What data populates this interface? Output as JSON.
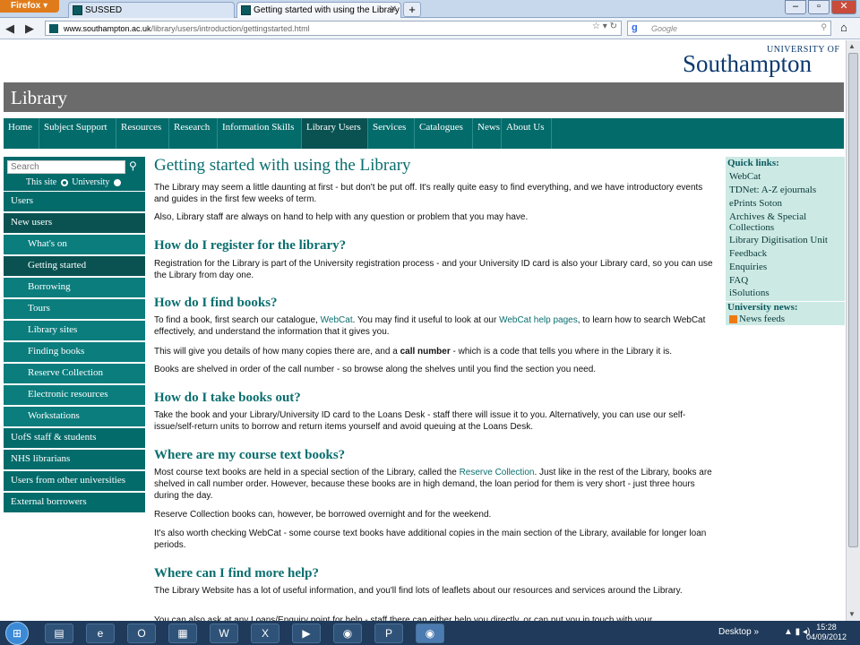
{
  "browser": {
    "firefox_label": "Firefox",
    "tabs": [
      {
        "label": "SUSSED"
      },
      {
        "label": "Getting started with using the Library ..."
      }
    ],
    "new_tab": "+",
    "url_host": "www.southampton.ac.uk",
    "url_path": "/library/users/introduction/gettingstarted.html",
    "search_engine": "Google",
    "search_placeholder": "Google"
  },
  "header": {
    "logo_university": "UNIVERSITY OF",
    "logo_name": "Southampton",
    "banner": "Library"
  },
  "main_nav": [
    {
      "label": "Home"
    },
    {
      "label": "Subject Support"
    },
    {
      "label": "Resources"
    },
    {
      "label": "Research"
    },
    {
      "label": "Information Skills"
    },
    {
      "label": "Library Users"
    },
    {
      "label": "Services"
    },
    {
      "label": "Catalogues"
    },
    {
      "label": "News"
    },
    {
      "label": "About Us"
    }
  ],
  "sidebar": {
    "search_placeholder": "Search",
    "scope_this_site": "This site",
    "scope_university": "University",
    "items": [
      {
        "label": "Users"
      },
      {
        "label": "New users"
      },
      {
        "label": "What's on"
      },
      {
        "label": "Getting started"
      },
      {
        "label": "Borrowing"
      },
      {
        "label": "Tours"
      },
      {
        "label": "Library sites"
      },
      {
        "label": "Finding books"
      },
      {
        "label": "Reserve Collection"
      },
      {
        "label": "Electronic resources"
      },
      {
        "label": "Workstations"
      },
      {
        "label": "UofS staff & students"
      },
      {
        "label": "NHS librarians"
      },
      {
        "label": "Users from other universities"
      },
      {
        "label": "External borrowers"
      }
    ]
  },
  "content": {
    "title": "Getting started with using the Library",
    "intro1": "The Library may seem a little daunting at first - but don't be put off. It's really quite easy to find everything, and we have introductory events and guides in the first few weeks of term.",
    "intro2": "Also, Library staff are always on hand to help with any question or problem that you may have.",
    "h_register": "How do I register for the library?",
    "p_register": "Registration for the Library is part of the University registration process - and your University ID card is also your Library card, so you can use the Library from day one.",
    "h_find": "How do I find books?",
    "p_find1_a": "To find a book, first search our catalogue,",
    "p_find1_link1": "WebCat",
    "p_find1_b": ". You may find it useful to look at our",
    "p_find1_link2": "WebCat help pages",
    "p_find1_c": ", to learn how to search WebCat effectively, and understand the information that it gives you.",
    "p_find2_a": "This will give you details of how many copies there are, and a",
    "p_find2_bold": "call number",
    "p_find2_b": "- which is a code that tells you where in the Library it is.",
    "p_find3": "Books are shelved in order of the call number - so browse along the shelves until you find the section you need.",
    "h_out": "How do I take books out?",
    "p_out": "Take the book and your Library/University ID card to the Loans Desk - staff there will issue it to you. Alternatively, you can use our self-issue/self-return units to borrow and return items yourself and avoid queuing at the Loans Desk.",
    "h_course": "Where are my course text books?",
    "p_course1_a": "Most course text books are held in a special section of the Library, called the",
    "p_course1_link": "Reserve Collection",
    "p_course1_b": ". Just like in the rest of the Library, books are shelved in call number order. However, because these books are in high demand, the loan period for them is very short - just three hours during the day.",
    "p_course2": "Reserve Collection books can, however, be borrowed overnight and for the weekend.",
    "p_course3": "It's also worth checking WebCat - some course text books have additional copies in the main section of the Library, available for longer loan periods.",
    "h_help": "Where can I find more help?",
    "p_help1": "The Library Website has a lot of useful information, and you'll find lots of leaflets about our resources and services around the Library.",
    "p_help2": "You can also ask at any Loans/Enquiry point for help - staff there can either help you directly, or can put you in touch with your"
  },
  "quick_links": {
    "heading": "Quick links:",
    "items": [
      {
        "label": "WebCat"
      },
      {
        "label": "TDNet: A-Z ejournals"
      },
      {
        "label": "ePrints Soton"
      },
      {
        "label": "Archives & Special"
      },
      {
        "label": "Collections"
      },
      {
        "label": "Library Digitisation Unit"
      },
      {
        "label": "Feedback"
      },
      {
        "label": "Enquiries"
      },
      {
        "label": "FAQ"
      },
      {
        "label": "iSolutions"
      }
    ],
    "news_heading": "University news:",
    "news_feeds": "News feeds"
  },
  "taskbar": {
    "desktop_label": "Desktop",
    "time": "15:28",
    "date": "04/09/2012"
  },
  "colors": {
    "teal": "#046b6b",
    "teal_dark": "#0a5252",
    "banner_grey": "#6b6b6b",
    "quick_bg": "#cce9e4",
    "heading_teal": "#0b6e6e"
  }
}
